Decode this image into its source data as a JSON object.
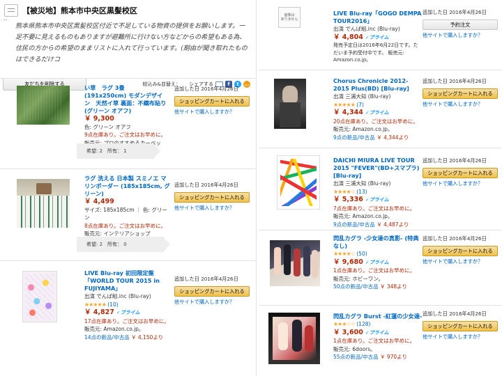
{
  "left": {
    "header_title": "【被災地】熊本市中央区黒髪校区",
    "quote": "熊本県熊本市中央区黒髪校区付近で不足している物資の提供をお願いします。一足不要に見えるものもありますが避難所に行けない方などからの希望もある為、住民の方からの希望のままリストに入れて行っています。(期由が聞き取れたものはできるだけコ",
    "remove_friends_button": "友だちを削除する",
    "filter_sort": "絞込み&並替え：",
    "share": "シェアする",
    "items": [
      {
        "title": "い草　ラグ 3畳 (191x250cm) モダンデザイン　天然イ草 裏面：不織布貼り (グリーン オアフ)",
        "price": "￥ 9,300",
        "color": "色: グリーン オアフ",
        "stock": "9点在庫あり。ご注文はお早めに。",
        "seller": "販売元: プロのすすめるカーペット。",
        "added": "追加した日 2016年4月26日",
        "cart": "ショッピングカートに入れる",
        "other": "他サイトで購入しますか？",
        "meta": "希望: 2　所有： 1"
      },
      {
        "title": "ラグ 洗える 日本製 スミノエ マリンボーダー (185x185cm, グリーン)",
        "price": "￥ 4,499",
        "color": "サイズ: 185x185cm ｜ 色: グリーン",
        "stock": "8点在庫あり。ご注文はお早めに。",
        "seller": "販売元: インテリアショップRug&Mat。",
        "added": "追加した日 2016年4月26日",
        "cart": "ショッピングカートに入れる",
        "other": "他サイトで購入しますか？",
        "meta": "希望: 2　所有： 0"
      },
      {
        "title": "LIVE Blu-ray 初回限定盤「WORLD TOUR 2015 in FUJIYAMA」",
        "maker": "出演 でんぱ組.inc (Blu-ray)",
        "stars": "★★★★★",
        "reviews": "(10)",
        "price": "￥ 4,827",
        "prime": "✓プライム",
        "stock": "17点在庫あり。ご注文はお早めに。",
        "seller": "販売元: Amazon.co.jp。",
        "used": "14点の新品/中古品",
        "used_price": "￥ 4,150より",
        "added": "追加した日 2016年4月26日",
        "cart": "ショッピングカートに入れる",
        "other": "他サイトで購入しますか？"
      }
    ]
  },
  "right": {
    "items": [
      {
        "thumb_text": "画像は\nありません",
        "title": "LIVE Blu-ray「GOGO DEMPA TOUR2016」",
        "maker": "出演 でんぱ組.inc (Blu-ray)",
        "price": "￥ 4,804",
        "prime": "✓プライム",
        "note": "発売予定日は2016年6月22日です。ただいま予約受付中です。 販売元: Amazon.co.jp。",
        "added": "追加した日 2016年4月26日",
        "cart": "予約注文",
        "other": "他サイトで購入しますか？"
      },
      {
        "title": "Chorus Chronicle 2012-2015 Plus(BD) [Blu-ray]",
        "maker": "出演 三浦大知 (Blu-ray)",
        "stars": "★★★★★",
        "reviews": "(7)",
        "price": "￥ 4,344",
        "prime": "✓プライム",
        "stock": "20点在庫あり。ご注文はお早めに。",
        "seller": "販売元: Amazon.co.jp。",
        "used": "9点の新品/中古品",
        "used_price": "￥ 4,344より",
        "added": "追加した日 2016年4月26日",
        "cart": "ショッピングカートに入れる",
        "other": "他サイトで購入しますか？"
      },
      {
        "title": "DAICHI MIURA LIVE TOUR 2015 \"FEVER\"(BD+スマプラ) [Blu-ray]",
        "maker": "出演 三浦大知 (Blu-ray)",
        "stars": "★★★★☆",
        "reviews": "(13)",
        "price": "￥ 5,336",
        "prime": "✓プライム",
        "stock": "7点在庫あり。ご注文はお早めに。",
        "seller": "販売元: Amazon.co.jp。",
        "used": "9点の新品/中古品",
        "used_price": "￥ 4,487より",
        "added": "追加した日 2016年4月26日",
        "cart": "ショッピングカートに入れる",
        "other": "他サイトで購入しますか？"
      },
      {
        "title": "閃乱カグラ -少女達の真影- (特典なし)",
        "stars": "★★★★☆",
        "reviews": "(50)",
        "price": "￥ 9,680",
        "prime": "✓プライム",
        "stock": "1点在庫あり。ご注文はお早めに。",
        "seller": "販売元: ホピーワン。",
        "used": "50点の新品/中古品",
        "used_price": "￥ 348より",
        "added": "追加した日 2016年4月26日",
        "cart": "ショッピングカートに入れる",
        "other": "他サイトで購入しますか？"
      },
      {
        "title": "閃乱カグラ Burst -紅蓮の少女達-",
        "stars": "★★★☆☆",
        "reviews": "(128)",
        "price": "￥ 3,600",
        "prime": "✓プライム",
        "stock": "1点在庫あり。ご注文はお早めに。",
        "seller": "販売元: 6doors。",
        "used": "55点の新品/中古品",
        "used_price": "￥ 970より",
        "added": "追加した日 2016年4月26日",
        "cart": "ショッピングカートに入れる",
        "other": "他サイトで購入しますか？"
      }
    ]
  }
}
